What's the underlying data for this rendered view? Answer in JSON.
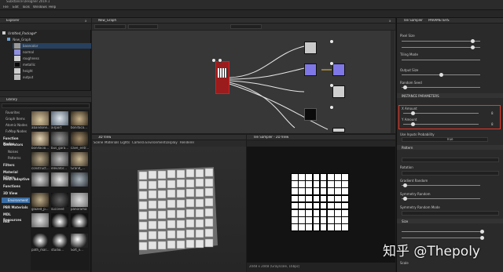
{
  "app": {
    "title": "Substance Designer 2019.1",
    "menus": [
      "File",
      "Edit",
      "Tools",
      "Windows",
      "Help"
    ]
  },
  "explorer": {
    "title": "Explorer",
    "package": "Untitled_Package*",
    "graph": "New_Graph",
    "items": [
      {
        "label": "basecolor",
        "swatch": "#9a9a9a"
      },
      {
        "label": "normal",
        "swatch": "#8f8fe0"
      },
      {
        "label": "roughness",
        "swatch": "#cfcfcf"
      },
      {
        "label": "metallic",
        "swatch": "#0a0a0a"
      },
      {
        "label": "height",
        "swatch": "#cfcfcf"
      },
      {
        "label": "output",
        "swatch": "#bdbdbd"
      }
    ]
  },
  "library": {
    "title": "Library",
    "categories": [
      "Favorites",
      "Graph Items",
      "Atomic Nodes",
      "FxMap Nodes",
      "Function Nodes",
      "Generators",
      "Noises",
      "Patterns",
      "Filters",
      "Material Filters",
      "Mesh Adaptive",
      "Functions",
      "3D View",
      "Environment",
      "PBR Materials",
      "MDL Resources",
      "mdl"
    ],
    "selected": "Environment",
    "thumbs": [
      [
        "abandone...",
        "airport",
        "bonifaco..."
      ],
      [
        "bonifacio...",
        "bus_gara...",
        "cave_entr..."
      ],
      [
        "construct...",
        "elevator...",
        "Grand_..."
      ],
      [
        "",
        "",
        ""
      ],
      [
        "glazed_p...",
        "succeed",
        "panorama"
      ],
      [
        "",
        "",
        ""
      ],
      [
        "path_mar...",
        "studio...",
        "Soft_li..."
      ]
    ]
  },
  "graph": {
    "tab": "New_Graph",
    "close": "x"
  },
  "view3d": {
    "title": "3D View",
    "menus": [
      "Scene",
      "Materials",
      "Lights",
      "Camera",
      "Environment",
      "Display",
      "Renderer"
    ]
  },
  "view2d": {
    "title": "Tile Sampler - 2D View",
    "status": "2048 x 2048 (Grayscale, 16bpc)"
  },
  "properties": {
    "tab": "Tile Sampler",
    "tab2": "PARAMETERS",
    "sections": {
      "pixel": {
        "label": "Pixel Size",
        "value": "Relative to parent"
      },
      "tiling": {
        "label": "Tiling Mode"
      },
      "output": {
        "label": "Output Size"
      },
      "random": {
        "label": "Random Seed"
      },
      "instance": {
        "label": "INSTANCE PARAMETERS"
      },
      "xamount": {
        "label": "X Amount",
        "value": "8"
      },
      "yamount": {
        "label": "Y Amount",
        "value": "8"
      },
      "grayscale": {
        "label": "Use Inputs Probability",
        "value": "True"
      },
      "pattern": {
        "label": "Pattern"
      },
      "rotation": {
        "label": "Rotation"
      },
      "gradient": {
        "label": "Gradient Random"
      },
      "symmetry": {
        "label": "Symmetry Random"
      },
      "symmetry_mode": {
        "label": "Symmetry Random Mode"
      },
      "size": {
        "label": "Size"
      },
      "scale": {
        "label": "Scale"
      }
    }
  },
  "watermark": "知乎 @Thepoly"
}
